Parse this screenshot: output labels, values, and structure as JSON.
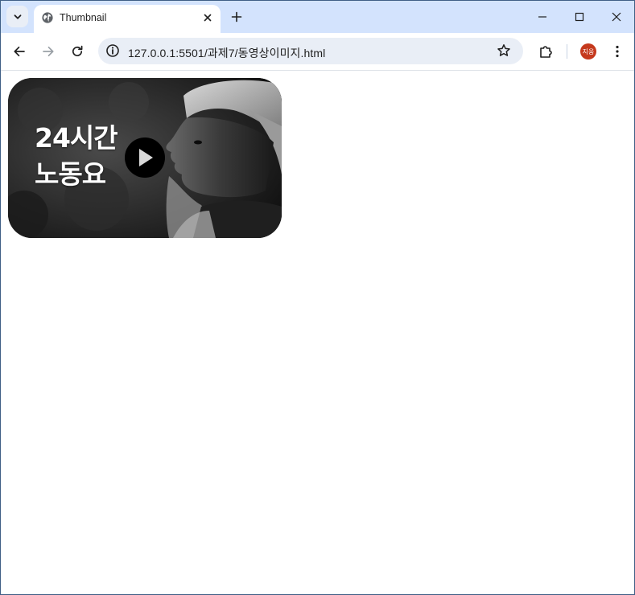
{
  "browser": {
    "tab": {
      "title": "Thumbnail"
    },
    "address_bar": {
      "url": "127.0.0.1:5501/과제7/동영상이미지.html"
    },
    "profile": {
      "initials": "지웅",
      "color": "#c5391d"
    }
  },
  "page": {
    "thumbnail": {
      "caption_line1": "24시간",
      "caption_line2": "노동요"
    }
  },
  "icons": {
    "tab_search": "chevron-down-icon",
    "favicon": "globe-icon",
    "close": "close-icon",
    "new_tab": "plus-icon",
    "minimize": "minimize-icon",
    "maximize": "maximize-icon",
    "window_close": "close-icon",
    "back": "arrow-left-icon",
    "forward": "arrow-right-icon",
    "reload": "reload-icon",
    "site_info": "info-icon",
    "bookmark": "star-icon",
    "extensions": "puzzle-icon",
    "menu": "kebab-menu-icon",
    "play": "play-icon"
  },
  "colors": {
    "tabstrip_bg": "#d3e3fd",
    "omnibox_bg": "#e9eef6",
    "window_border": "#3f5f86"
  }
}
